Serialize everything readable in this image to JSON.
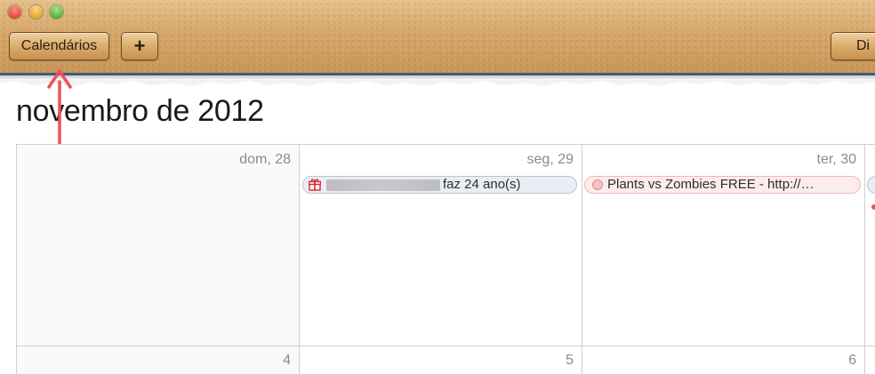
{
  "window": {
    "controls": [
      "close",
      "minimize",
      "zoom"
    ]
  },
  "toolbar": {
    "calendars_label": "Calendários",
    "add_label": "+",
    "day_label_partial": "Di"
  },
  "month_title": "novembro de 2012",
  "weeks": [
    {
      "days": [
        {
          "label": "dom, 28"
        },
        {
          "label": "seg, 29"
        },
        {
          "label": "ter, 30"
        }
      ]
    },
    {
      "days": [
        {
          "label": "4"
        },
        {
          "label": "5"
        },
        {
          "label": "6"
        }
      ]
    }
  ],
  "events": {
    "birthday": {
      "icon": "gift-icon",
      "suffix": "faz 24 ano(s)",
      "color": "#eaeef4"
    },
    "plants": {
      "title": "Plants vs Zombies FREE - http://…",
      "color": "#fdecec"
    }
  },
  "annotation": {
    "color": "#f0505a"
  }
}
